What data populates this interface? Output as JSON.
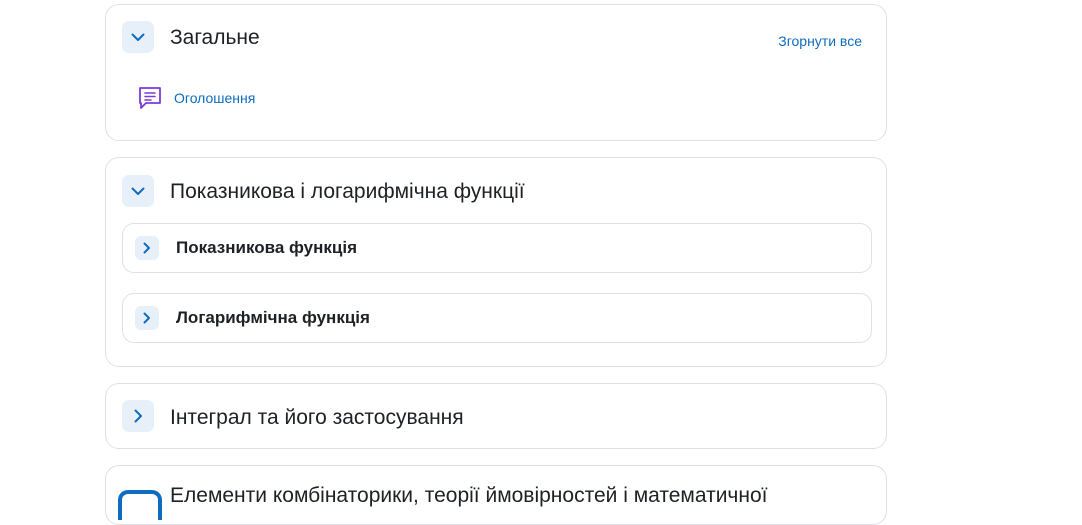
{
  "sections": [
    {
      "title": "Загальне",
      "collapse_all": "Згорнути все",
      "activity": {
        "icon": "forum-icon",
        "label": "Оголошення"
      }
    },
    {
      "title": "Показникова і логарифмічна функції",
      "subsections": [
        {
          "title": "Показникова функція"
        },
        {
          "title": "Логарифмічна функція"
        }
      ]
    },
    {
      "title": "Інтеграл та його застосування"
    },
    {
      "title": "Елементи комбінаторики, теорії ймовірностей і математичної"
    }
  ],
  "colors": {
    "accent": "#0f6cbf",
    "toggle_bg": "#e7eff8",
    "border": "#dee2e6",
    "activity_icon": "#7b3ad9"
  }
}
